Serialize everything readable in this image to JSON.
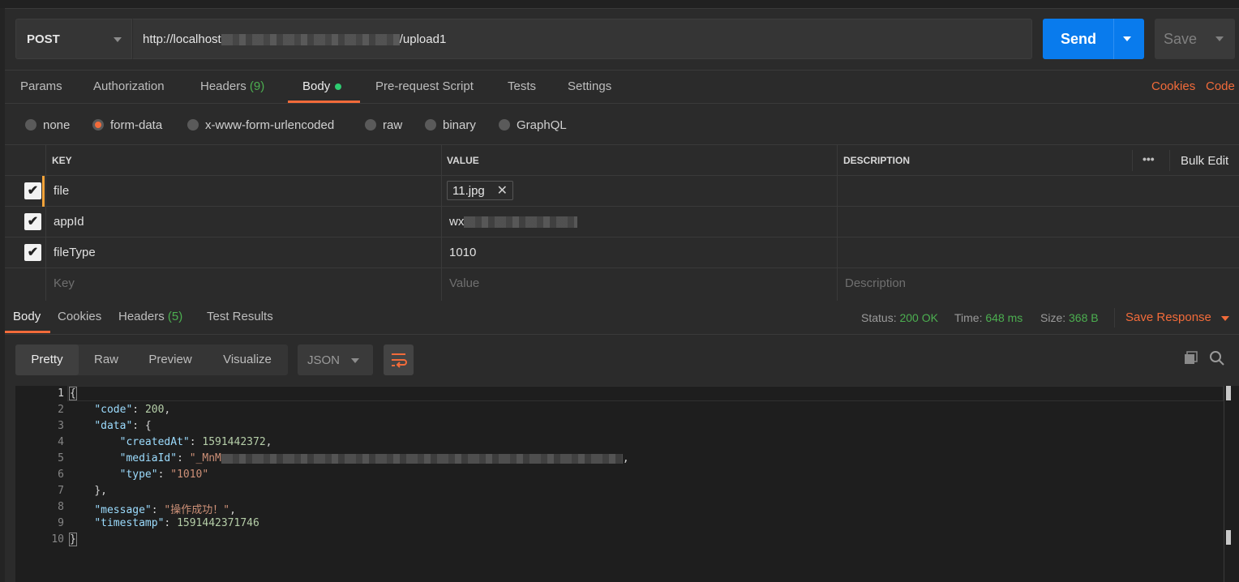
{
  "request": {
    "method": "POST",
    "url_start": "http://localhost",
    "url_end": "/upload1",
    "send_label": "Send",
    "save_label": "Save"
  },
  "request_tabs": [
    {
      "label": "Params"
    },
    {
      "label": "Authorization"
    },
    {
      "label": "Headers",
      "count": "(9)"
    },
    {
      "label": "Body"
    },
    {
      "label": "Pre-request Script"
    },
    {
      "label": "Tests"
    },
    {
      "label": "Settings"
    }
  ],
  "right_links": {
    "cookies": "Cookies",
    "code": "Code"
  },
  "body_types": [
    "none",
    "form-data",
    "x-www-form-urlencoded",
    "raw",
    "binary",
    "GraphQL"
  ],
  "table": {
    "headers": {
      "key": "KEY",
      "value": "VALUE",
      "description": "DESCRIPTION",
      "more": "•••",
      "bulk_edit": "Bulk Edit"
    },
    "rows": [
      {
        "key": "file",
        "value": "11.jpg"
      },
      {
        "key": "appId",
        "value": "wx"
      },
      {
        "key": "fileType",
        "value": "1010"
      }
    ],
    "placeholders": {
      "key": "Key",
      "value": "Value",
      "description": "Description"
    }
  },
  "response": {
    "tabs": [
      {
        "label": "Body"
      },
      {
        "label": "Cookies"
      },
      {
        "label": "Headers",
        "count": "(5)"
      },
      {
        "label": "Test Results"
      }
    ],
    "status_label": "Status:",
    "status_value": "200 OK",
    "time_label": "Time:",
    "time_value": "648 ms",
    "size_label": "Size:",
    "size_value": "368 B",
    "save_response": "Save Response",
    "view_tabs": [
      "Pretty",
      "Raw",
      "Preview",
      "Visualize"
    ],
    "format": "JSON"
  },
  "code": {
    "line_numbers": [
      "1",
      "2",
      "3",
      "4",
      "5",
      "6",
      "7",
      "8",
      "9",
      "10"
    ],
    "k_code": "\"code\"",
    "v_code": "200",
    "k_data": "\"data\"",
    "k_createdAt": "\"createdAt\"",
    "v_createdAt": "1591442372",
    "k_mediaId": "\"mediaId\"",
    "v_mediaId": "\"_MnM",
    "k_type": "\"type\"",
    "v_type": "\"1010\"",
    "k_message": "\"message\"",
    "v_message": "\"操作成功！\"",
    "k_timestamp": "\"timestamp\"",
    "v_timestamp": "1591442371746"
  },
  "colors": {
    "accent": "#f26b3a",
    "send": "#097bed",
    "ok": "#4caf50"
  }
}
